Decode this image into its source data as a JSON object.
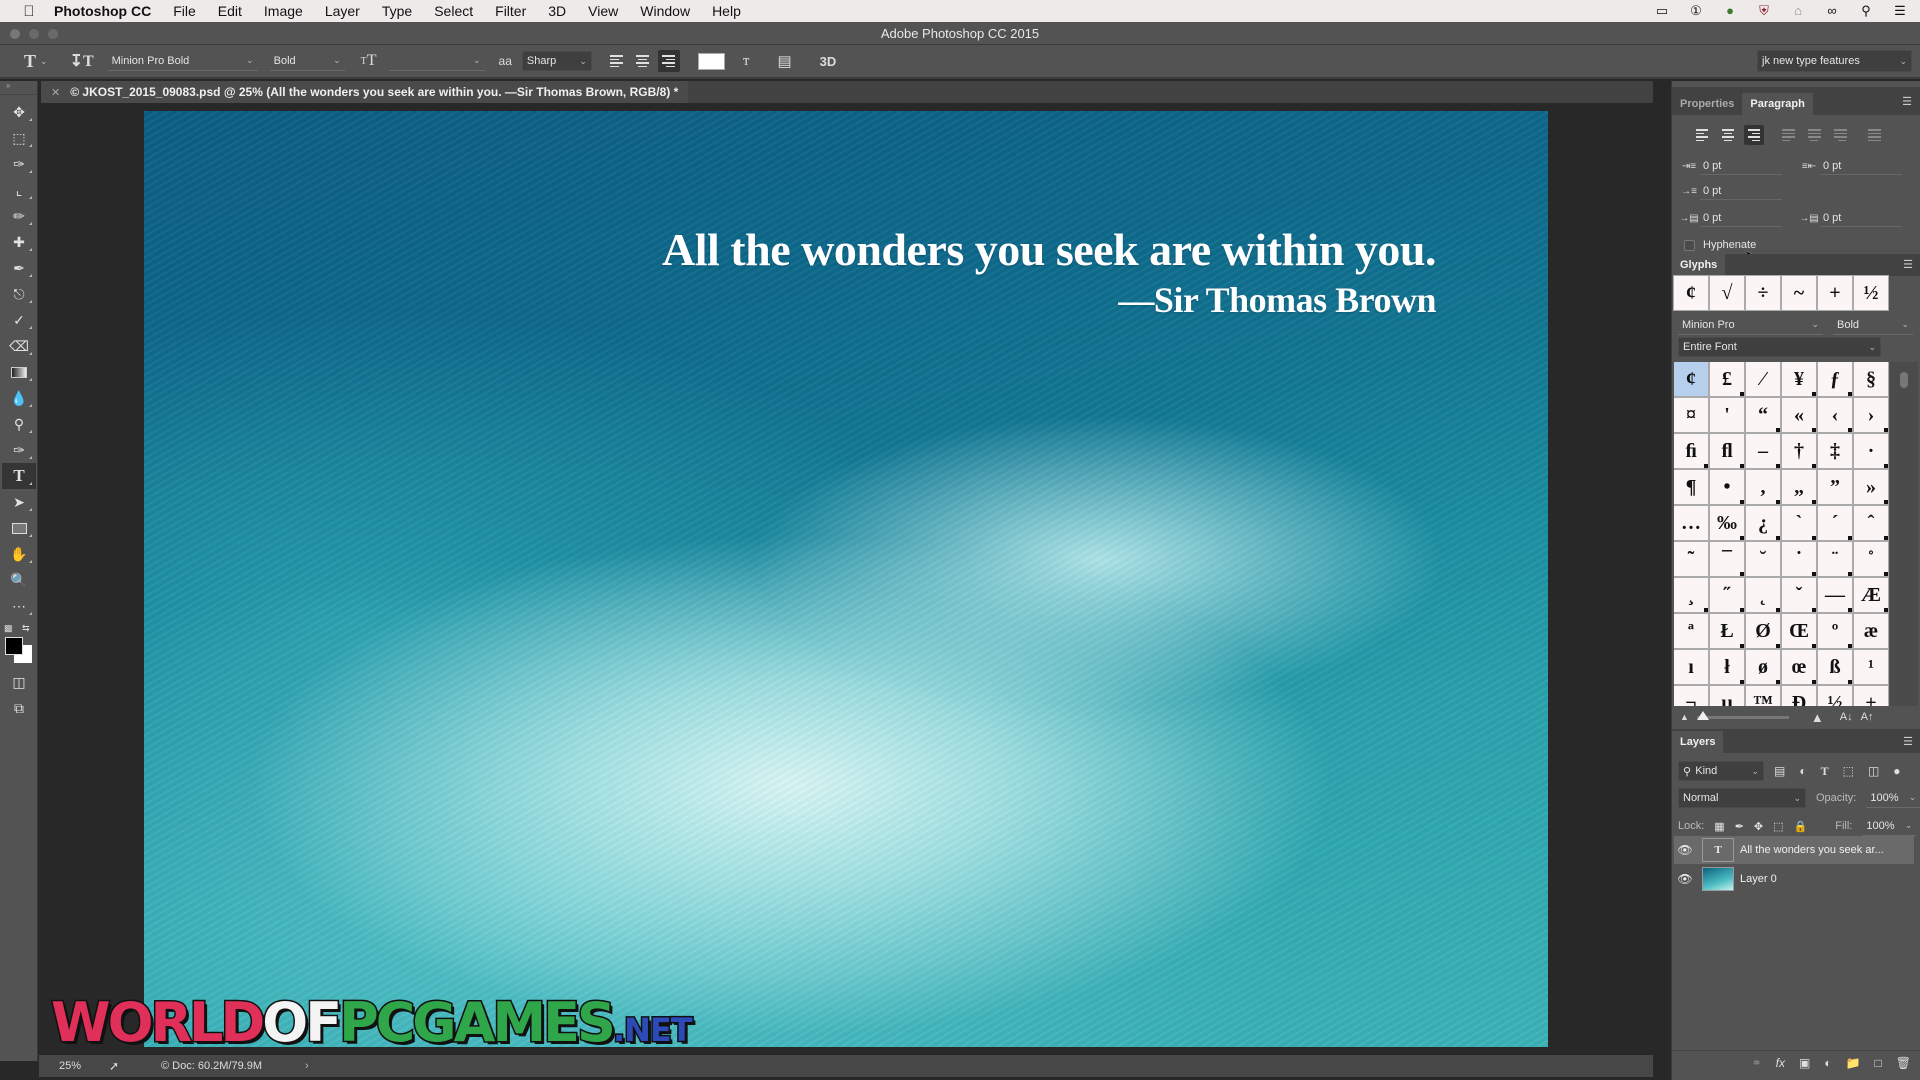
{
  "menubar": {
    "app_name": "Photoshop CC",
    "items": [
      "File",
      "Edit",
      "Image",
      "Layer",
      "Type",
      "Select",
      "Filter",
      "3D",
      "View",
      "Window",
      "Help"
    ],
    "tray_icons": [
      "display-icon",
      "1password-icon",
      "keychain-icon",
      "mcafee-icon",
      "home-icon",
      "creative-cloud-icon",
      "spotlight-search-icon",
      "notification-center-icon"
    ]
  },
  "window": {
    "title": "Adobe Photoshop CC 2015"
  },
  "options_bar": {
    "tool_icon": "T",
    "font_family": "Minion Pro Bold",
    "font_style": "Bold",
    "font_size": "",
    "antialias_icon": "aa",
    "antialias": "Sharp",
    "alignment_active": "right",
    "text_color": "#ffffff",
    "workspace": "jk new type features",
    "three_d_label": "3D"
  },
  "document": {
    "tab_title": "© JKOST_2015_09083.psd @ 25% (All the wonders you seek are within you. —Sir Thomas Brown, RGB/8) *",
    "quote_line1": "All the wonders you seek are within you.",
    "quote_line2": "—Sir Thomas Brown",
    "watermark": {
      "part1": "WORLD",
      "part2": "OF",
      "part3": "PCGAMES",
      "part4": ".NET"
    }
  },
  "status_bar": {
    "zoom": "25%",
    "doc_size": "© Doc: 60.2M/79.9M",
    "more": "›"
  },
  "colors": {
    "foreground": "#000000",
    "background": "#ffffff"
  },
  "paragraph_panel": {
    "tabs": [
      {
        "label": "Properties",
        "active": false
      },
      {
        "label": "Paragraph",
        "active": true
      }
    ],
    "indent_left": "0 pt",
    "indent_right": "0 pt",
    "indent_first_line": "0 pt",
    "space_before": "0 pt",
    "space_after": "0 pt",
    "hyphenate_label": "Hyphenate",
    "hyphenate_checked": false
  },
  "glyphs_panel": {
    "title": "Glyphs",
    "recent": [
      "¢",
      "√",
      "÷",
      "~",
      "+",
      "½"
    ],
    "font": "Minion Pro",
    "style": "Bold",
    "filter": "Entire Font",
    "grid": [
      "¢",
      "£",
      "⁄",
      "¥",
      "ƒ",
      "§",
      "¤",
      "'",
      "“",
      "«",
      "‹",
      "›",
      "ﬁ",
      "ﬂ",
      "–",
      "†",
      "‡",
      "·",
      "¶",
      "•",
      "‚",
      "„",
      "”",
      "»",
      "…",
      "‰",
      "¿",
      "`",
      "´",
      "ˆ",
      "˜",
      "¯",
      "˘",
      "˙",
      "¨",
      "˚",
      "¸",
      "˝",
      "˛",
      "ˇ",
      "—",
      "Æ",
      "ª",
      "Ł",
      "Ø",
      "Œ",
      "º",
      "æ",
      "ı",
      "ł",
      "ø",
      "œ",
      "ß",
      "¹",
      "¬",
      "µ",
      "™",
      "Ð",
      "½",
      "±"
    ]
  },
  "layers_panel": {
    "title": "Layers",
    "filter_kind": "Kind",
    "blend_mode": "Normal",
    "opacity_label": "Opacity:",
    "opacity": "100%",
    "lock_label": "Lock:",
    "fill_label": "Fill:",
    "fill": "100%",
    "layers": [
      {
        "name": "All the wonders you seek ar...",
        "type": "text",
        "visible": true,
        "selected": true
      },
      {
        "name": "Layer 0",
        "type": "image",
        "visible": true,
        "selected": false
      }
    ]
  }
}
